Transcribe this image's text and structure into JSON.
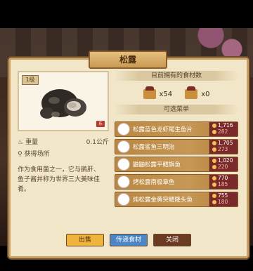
{
  "dialog": {
    "title": "松露",
    "badge": "1级",
    "weight_label": "重量",
    "weight_value": "0.1公斤",
    "source_label": "获得场所",
    "description": "作为食用菌之一，它与鹅肝、鱼子酱并称为世界三大美味佳肴。"
  },
  "owned": {
    "header": "目前拥有的食材数",
    "item1_count": "x54",
    "item2_count": "x0"
  },
  "recipes": {
    "header": "可选菜单",
    "items": [
      {
        "name": "松露蓝色龙虾尾生鱼片",
        "price1": "1,716",
        "price2": "282"
      },
      {
        "name": "松露鲨鱼三明治",
        "price1": "1,705",
        "price2": "273"
      },
      {
        "name": "鼬鼬松露平鳍旗鱼",
        "price1": "1,020",
        "price2": "220"
      },
      {
        "name": "烤松露南极章鱼",
        "price1": "770",
        "price2": "185"
      },
      {
        "name": "炖松露金黄突鳍隆头鱼",
        "price1": "755",
        "price2": "180"
      }
    ]
  },
  "buttons": {
    "sell": "出售",
    "send": "传递食材",
    "close": "关闭"
  },
  "seal_text": "东"
}
